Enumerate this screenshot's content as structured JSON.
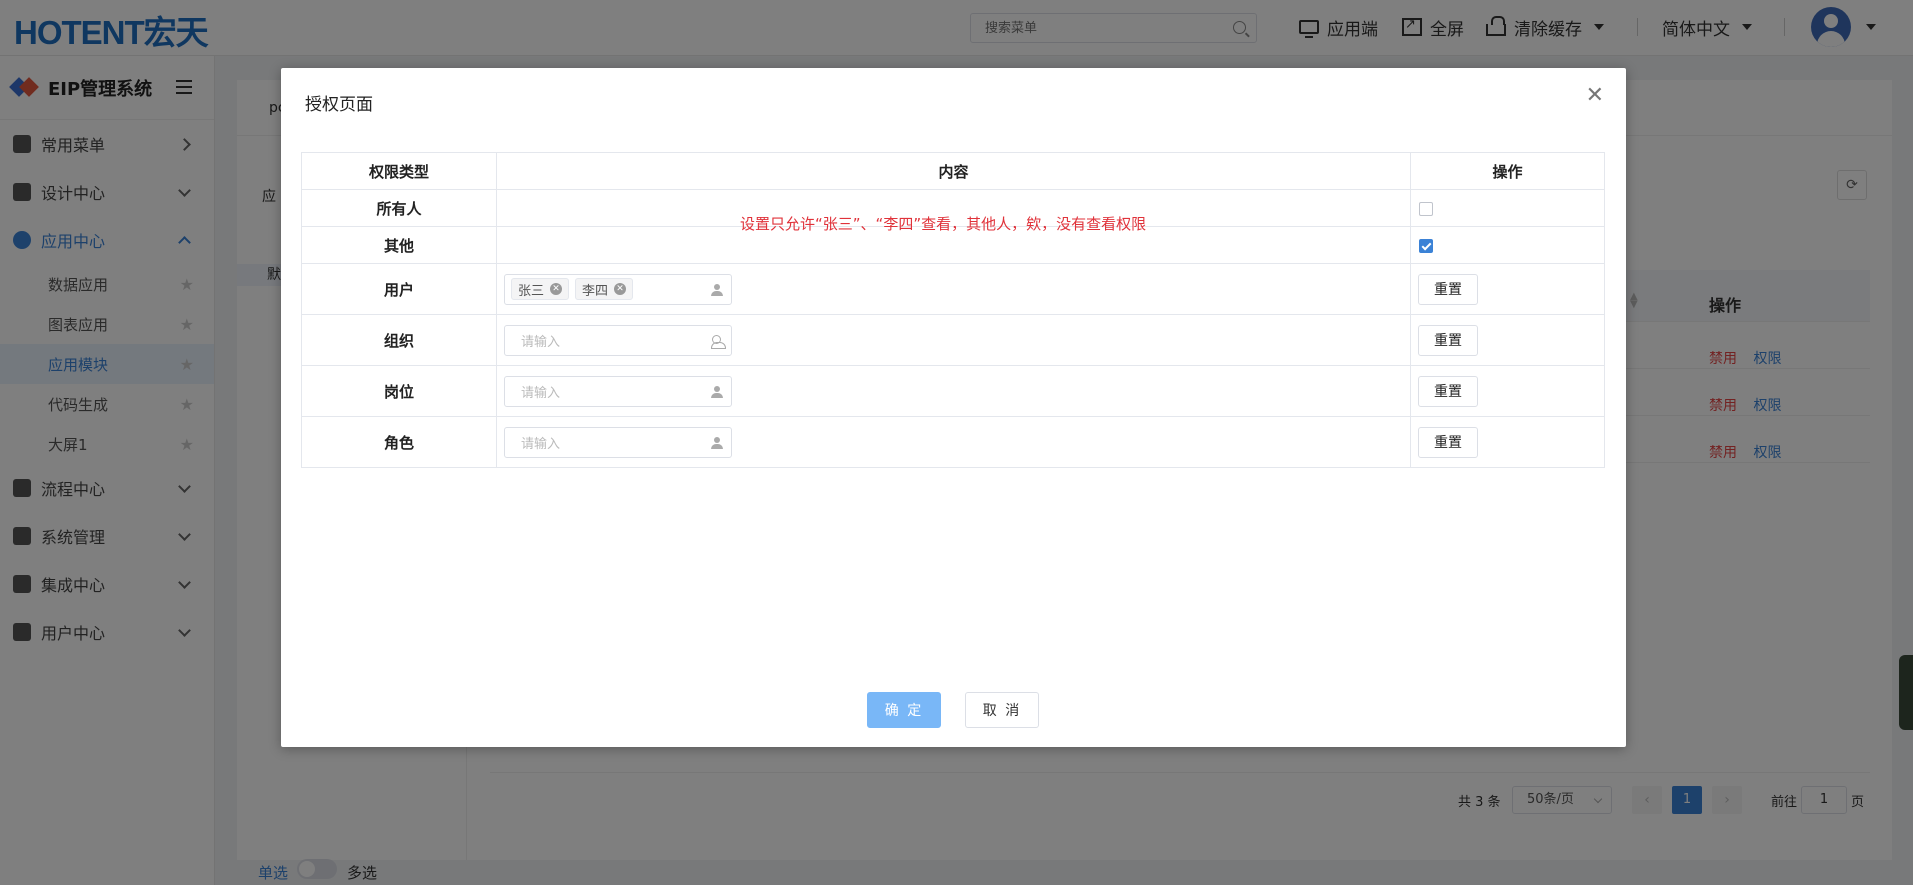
{
  "header": {
    "logo_text": "HOTENT宏天",
    "search_placeholder": "搜索菜单",
    "actions": {
      "app_client": "应用端",
      "fullscreen": "全屏",
      "clear_cache": "清除缓存",
      "language": "简体中文"
    }
  },
  "sidebar": {
    "system_title": "EIP管理系统",
    "menu": [
      {
        "label": "常用菜单",
        "icon": "grid-icon"
      },
      {
        "label": "设计中心",
        "icon": "design-icon"
      },
      {
        "label": "应用中心",
        "icon": "apps-icon"
      },
      {
        "label": "流程中心",
        "icon": "flow-icon"
      },
      {
        "label": "系统管理",
        "icon": "gear-icon"
      },
      {
        "label": "集成中心",
        "icon": "layers-icon"
      },
      {
        "label": "用户中心",
        "icon": "user-icon"
      }
    ],
    "submenu": [
      "数据应用",
      "图表应用",
      "应用模块",
      "代码生成",
      "大屏1"
    ],
    "active_submenu": "应用模块",
    "single_label": "单选",
    "multi_label": "多选"
  },
  "background": {
    "tab_label": "pc",
    "tree_root": "应",
    "tree_selected": "默",
    "table_op_header": "操作",
    "row_actions": {
      "disable": "禁用",
      "permission": "权限"
    },
    "row_count": 3
  },
  "pagination": {
    "total": "共 3 条",
    "page_size": "50条/页",
    "current_page": "1",
    "goto_label": "前往",
    "goto_value": "1",
    "page_suffix": "页"
  },
  "dialog": {
    "title": "授权页面",
    "columns": {
      "type": "权限类型",
      "content": "内容",
      "action": "操作"
    },
    "rows": {
      "everyone": {
        "label": "所有人",
        "checked": false
      },
      "other": {
        "label": "其他",
        "checked": true
      },
      "user": {
        "label": "用户",
        "tags": [
          "张三",
          "李四"
        ],
        "reset": "重置"
      },
      "org": {
        "label": "组织",
        "placeholder": "请输入",
        "reset": "重置"
      },
      "position": {
        "label": "岗位",
        "placeholder": "请输入",
        "reset": "重置"
      },
      "role": {
        "label": "角色",
        "placeholder": "请输入",
        "reset": "重置"
      }
    },
    "note": "设置只允许“张三”、“李四”查看，其他人，欸，没有查看权限",
    "confirm": "确 定",
    "cancel": "取 消"
  },
  "colors": {
    "primary": "#3b82d6",
    "danger": "#e64545",
    "note": "#e0323a",
    "confirm_disabled": "#79b7f7"
  }
}
